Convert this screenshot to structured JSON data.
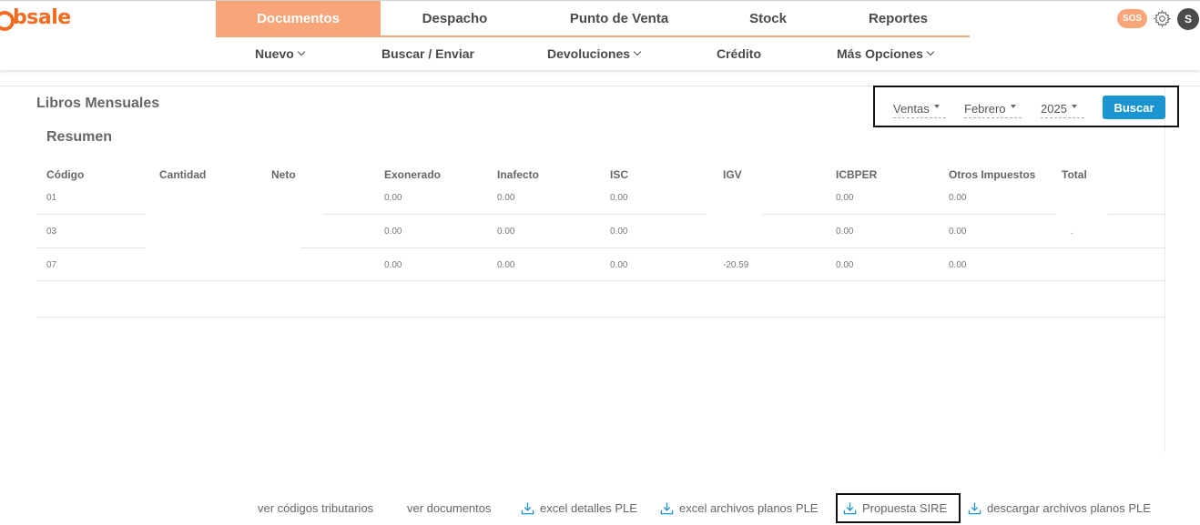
{
  "brand": {
    "name": "bsale",
    "color": "#f36b21"
  },
  "header": {
    "tabs": [
      {
        "label": "Documentos",
        "active": true
      },
      {
        "label": "Despacho",
        "active": false
      },
      {
        "label": "Punto de Venta",
        "active": false
      },
      {
        "label": "Stock",
        "active": false
      },
      {
        "label": "Reportes",
        "active": false
      }
    ],
    "sos_label": "SOS",
    "avatar_initial": "S",
    "accent_color": "#f9a57a"
  },
  "subnav": {
    "items": [
      {
        "label": "Nuevo",
        "dropdown": true
      },
      {
        "label": "Buscar / Enviar",
        "dropdown": false
      },
      {
        "label": "Devoluciones",
        "dropdown": true
      },
      {
        "label": "Crédito",
        "dropdown": false
      },
      {
        "label": "Más Opciones",
        "dropdown": true
      }
    ]
  },
  "page": {
    "title": "Libros Mensuales",
    "section": "Resumen"
  },
  "filters": {
    "book": "Ventas",
    "month": "Febrero",
    "year": "2025",
    "search_label": "Buscar",
    "button_color": "#1b95d0"
  },
  "table": {
    "columns": [
      "Código",
      "Cantidad",
      "Neto",
      "Exonerado",
      "Inafecto",
      "ISC",
      "IGV",
      "ICBPER",
      "Otros Impuestos",
      "Total"
    ],
    "rows": [
      {
        "codigo": "01",
        "cantidad": "",
        "neto": "",
        "exonerado": "0.00",
        "inafecto": "0.00",
        "isc": "0.00",
        "igv": "",
        "icbper": "0.00",
        "otros": "0.00",
        "total": ""
      },
      {
        "codigo": "03",
        "cantidad": "",
        "neto": "",
        "exonerado": "0.00",
        "inafecto": "0.00",
        "isc": "0.00",
        "igv": "",
        "icbper": "0.00",
        "otros": "0.00",
        "total": "."
      },
      {
        "codigo": "07",
        "cantidad": "",
        "neto": "",
        "exonerado": "0.00",
        "inafecto": "0.00",
        "isc": "0.00",
        "igv": "-20.59",
        "icbper": "0.00",
        "otros": "0.00",
        "total": ""
      }
    ]
  },
  "footer": {
    "links": [
      {
        "label": "ver códigos tributarios",
        "icon": null
      },
      {
        "label": "ver documentos",
        "icon": null
      },
      {
        "label": "excel detalles PLE",
        "icon": "download-icon"
      },
      {
        "label": "excel archivos planos PLE",
        "icon": "download-icon"
      },
      {
        "label": "Propuesta SIRE",
        "icon": "download-icon"
      },
      {
        "label": "descargar archivos planos PLE",
        "icon": "download-icon"
      }
    ]
  }
}
